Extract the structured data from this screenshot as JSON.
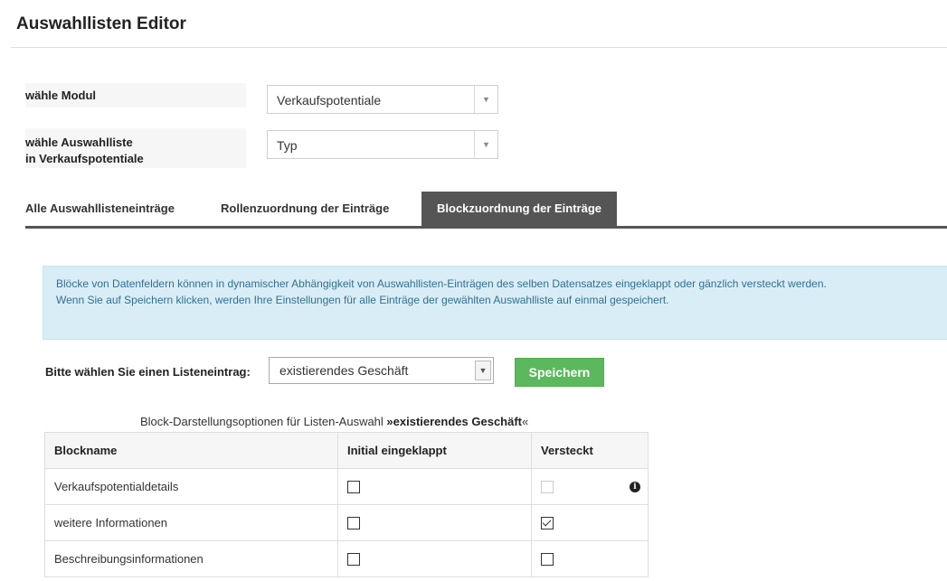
{
  "page": {
    "title": "Auswahllisten Editor"
  },
  "form": {
    "module_label": "wähle Modul",
    "module_value": "Verkaufspotentiale",
    "list_label_line1": "wähle Auswahlliste",
    "list_label_line2": "in Verkaufspotentiale",
    "list_value": "Typ"
  },
  "tabs": [
    {
      "label": "Alle Auswahllisteneinträge",
      "active": false
    },
    {
      "label": "Rollenzuordnung der Einträge",
      "active": false
    },
    {
      "label": "Blockzuordnung der Einträge",
      "active": true
    }
  ],
  "alert": {
    "line1": "Blöcke von Datenfeldern können in dynamischer Abhängigkeit von Auswahllisten-Einträgen des selben Datensatzes eingeklappt oder gänzlich versteckt werden.",
    "line2": "Wenn Sie auf Speichern klicken, werden Ihre Einstellungen für alle Einträge der gewählten Auswahlliste auf einmal gespeichert."
  },
  "picker": {
    "label": "Bitte wählen Sie einen Listeneintrag:",
    "value": "existierendes Geschäft",
    "save_label": "Speichern"
  },
  "table": {
    "caption_prefix": "Block-Darstellungsoptionen für Listen-Auswahl ",
    "caption_bold": "»existierendes Geschäft",
    "caption_suffix": "«",
    "headers": [
      "Blockname",
      "Initial eingeklappt",
      "Versteckt"
    ],
    "rows": [
      {
        "name": "Verkaufspotentialdetails",
        "collapsed": false,
        "hidden": false,
        "hidden_disabled": true,
        "info": true
      },
      {
        "name": "weitere Informationen",
        "collapsed": false,
        "hidden": true,
        "hidden_disabled": false,
        "info": false
      },
      {
        "name": "Beschreibungsinformationen",
        "collapsed": false,
        "hidden": false,
        "hidden_disabled": false,
        "info": false
      }
    ]
  },
  "icons": {
    "dropdown": "chevron-down-icon",
    "info": "info-icon"
  }
}
